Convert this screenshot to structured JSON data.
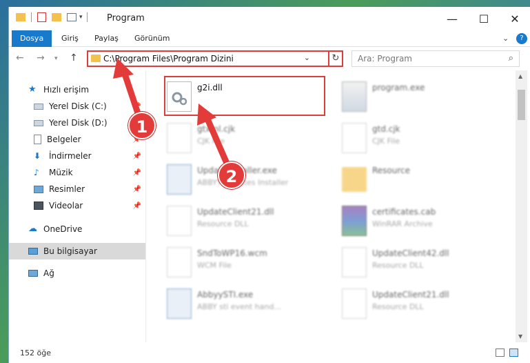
{
  "window": {
    "title": "Program",
    "controls": {
      "minimize": "—",
      "maximize": "☐",
      "close": "✕"
    }
  },
  "ribbon": {
    "tabs": [
      "Dosya",
      "Giriş",
      "Paylaş",
      "Görünüm"
    ],
    "expand": "⌄",
    "help": "?"
  },
  "address": {
    "path": "C:\\Program Files\\Program Dizini",
    "dropdown": "⌄",
    "refresh": "↻"
  },
  "search": {
    "placeholder": "Ara: Program",
    "icon": "⌕"
  },
  "nav": {
    "quick_access": "Hızlı erişim",
    "items": [
      {
        "label": "Yerel Disk (C:)",
        "icon": "drive-icon",
        "pinned": true
      },
      {
        "label": "Yerel Disk (D:)",
        "icon": "drive-icon",
        "pinned": false
      },
      {
        "label": "Belgeler",
        "icon": "documents-icon",
        "pinned": true
      },
      {
        "label": "İndirmeler",
        "icon": "download-icon",
        "pinned": true
      },
      {
        "label": "Müzik",
        "icon": "music-icon",
        "pinned": true
      },
      {
        "label": "Resimler",
        "icon": "pictures-icon",
        "pinned": true
      },
      {
        "label": "Videolar",
        "icon": "videos-icon",
        "pinned": true
      }
    ],
    "onedrive": "OneDrive",
    "this_pc": "Bu bilgisayar",
    "network": "Ağ"
  },
  "files": [
    {
      "name": "g2i.dll",
      "type": "",
      "highlighted": true
    },
    {
      "name": "program.exe",
      "type": ""
    },
    {
      "name": "gtxml.cjk",
      "type": "CJK File"
    },
    {
      "name": "gtd.cjk",
      "type": "CJK File"
    },
    {
      "name": "UpdateInstaller.exe",
      "type": "ABBYY Updates Installer"
    },
    {
      "name": "Resource",
      "type": ""
    },
    {
      "name": "UpdateClient21.dll",
      "type": "Resource DLL"
    },
    {
      "name": "certificates.cab",
      "type": "WinRAR Archive"
    },
    {
      "name": "SndToWP16.wcm",
      "type": "WCM File"
    },
    {
      "name": "UpdateClient42.dll",
      "type": "Resource DLL"
    },
    {
      "name": "AbbyySTI.exe",
      "type": "ABBY sti event hand..."
    },
    {
      "name": "UpdateClient21.dll",
      "type": "Resource DLL"
    }
  ],
  "annotations": {
    "step1": "1",
    "step2": "2"
  },
  "status": {
    "count": "152 öğe"
  },
  "colors": {
    "accent": "#1979ca",
    "highlight": "#e03b3b",
    "folder": "#f3c14c"
  }
}
